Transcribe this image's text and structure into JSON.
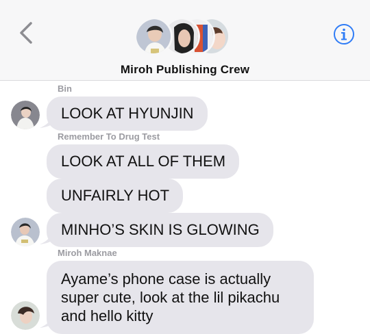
{
  "header": {
    "group_name": "Miroh Publishing Crew",
    "back_icon": "chevron-left-icon",
    "info_icon": "info-circle-icon",
    "accent_color": "#2f7cf6",
    "avatar_count": 4
  },
  "messages": [
    {
      "sender": "Bin",
      "text": "LOOK AT HYUNJIN"
    },
    {
      "sender": "Remember To Drug Test",
      "text": "LOOK AT ALL OF THEM"
    },
    {
      "sender": "",
      "text": "UNFAIRLY HOT"
    },
    {
      "sender": "",
      "text": "MINHO’S SKIN IS GLOWING"
    },
    {
      "sender": "Miroh Maknae",
      "text": "Ayame’s phone case is actually super cute, look at the lil pikachu and hello kitty"
    }
  ]
}
